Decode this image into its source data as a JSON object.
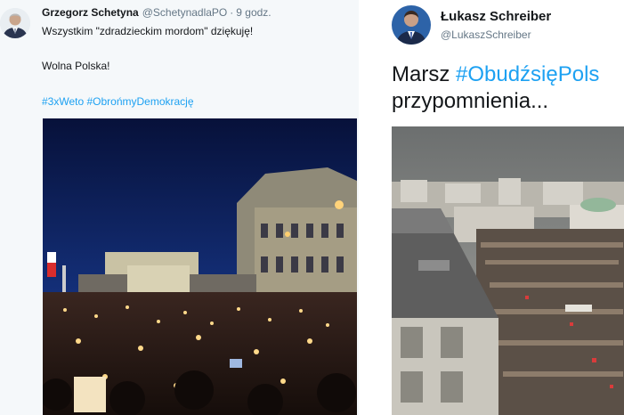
{
  "left_tweet": {
    "author_name": "Grzegorz Schetyna",
    "author_handle": "@SchetynadlaPO",
    "separator": "·",
    "timestamp": "9 godz.",
    "text_line1": "Wszystkim \"zdradzieckim mordom\" dziękuję!",
    "text_line2": "Wolna Polska!",
    "hashtags": [
      "#3xWeto",
      "#ObrońmyDemokrację"
    ]
  },
  "right_tweet": {
    "author_name": "Łukasz Schreiber",
    "author_handle": "@LukaszSchreiber",
    "text_prefix": "Marsz ",
    "hashtag": "#ObudźsięPols",
    "text_line2": "przypomnienia..."
  },
  "colors": {
    "link": "#1da1f2",
    "name": "#14171a",
    "meta": "#657786",
    "left_background": "#f5f8fa"
  },
  "icons": {
    "left_avatar": "avatar-photo",
    "right_avatar": "avatar-photo"
  }
}
